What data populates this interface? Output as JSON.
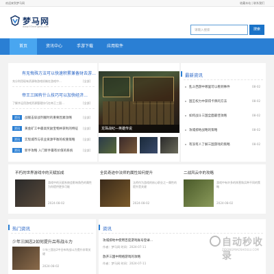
{
  "topbar": {
    "welcome": "欢迎来到梦马网",
    "links": "收藏本站 | 联系我们"
  },
  "site": {
    "name": "梦马网",
    "url": "www.93mengma.com"
  },
  "search": {
    "placeholder": "请输入搜索",
    "button": "搜索"
  },
  "nav": [
    "首页",
    "资讯中心",
    "手游下载",
    "应用软件"
  ],
  "featured": [
    {
      "title": "有无悔殊方法可以快速积累兼备财去游…",
      "summary": "充分利用现有资源和游戏机制在游戏中…",
      "more": "[全部]"
    },
    {
      "title": "帝王三国有什么技巧可以加快经济…",
      "summary": "了解并运用游戏资源管理技巧在帝王三国…",
      "more": "[全部]"
    }
  ],
  "news_list": [
    {
      "tag": "资讯",
      "title": "战舰击穿战列舰时的重要因素攻略",
      "more": "[全部]"
    },
    {
      "tag": "资讯",
      "title": "黄金矿工中最高奖励宝物并获利的特征",
      "more": "[全部]"
    },
    {
      "tag": "资讯",
      "title": "实现城市与农业资源平衡的权重策略",
      "more": "[全部]"
    },
    {
      "tag": "资讯",
      "title": "新手攻略 入门新手最有价值的系统",
      "more": "[全部]"
    }
  ],
  "banner_caption": "龙珠战纪—英雄传说",
  "latest": {
    "title": "最新资讯",
    "items": [
      {
        "title": "乱斗西游中哪里可以看到事件",
        "date": "08-02"
      },
      {
        "title": "国王权力中获得卡牌的方法",
        "date": "08-02"
      },
      {
        "title": "如何战斗三国全面最佳攻略",
        "date": "08-02"
      },
      {
        "title": "攻城掠地战略的策略",
        "date": "08-02"
      },
      {
        "title": "有没有人了解三国游戏的策略",
        "date": "08-02"
      }
    ]
  },
  "cards": [
    {
      "title": "不朽的世界游戏中的天赋加成",
      "desc": "游戏中的天赋系统会影响角色的属性为你提供更多可能",
      "date": "2024-08-02"
    },
    {
      "title": "全民奇迹中法师的属性如何提升",
      "desc": "法师作为游戏的核心职业之一属性的提升是关键",
      "date": "2024-08-02"
    },
    {
      "title": "二战风云中的攻略",
      "desc": "游戏中有许多的阵营和兵种不同的策略",
      "date": "2024-08-02"
    }
  ],
  "hot": {
    "title": "热门资讯",
    "lead": "少年三国志2如何提升吕布战斗力",
    "desc": "少年三国志2中吕布的战斗力提升非常关键",
    "date": "2024-08-02"
  },
  "news2": {
    "title": "资讯",
    "items": [
      {
        "title": "攻城掠地中使用百度游戏账号登录…",
        "meta": "作者：梦马网  时间：2024-07-11"
      },
      {
        "title": "放开三国中网络游戏的攻略",
        "meta": "作者：梦马网  时间：2024-07-11"
      }
    ]
  },
  "watermark": {
    "big": "自动秒收录",
    "small": "ZIDONGMIAOSHOULU.COM"
  }
}
